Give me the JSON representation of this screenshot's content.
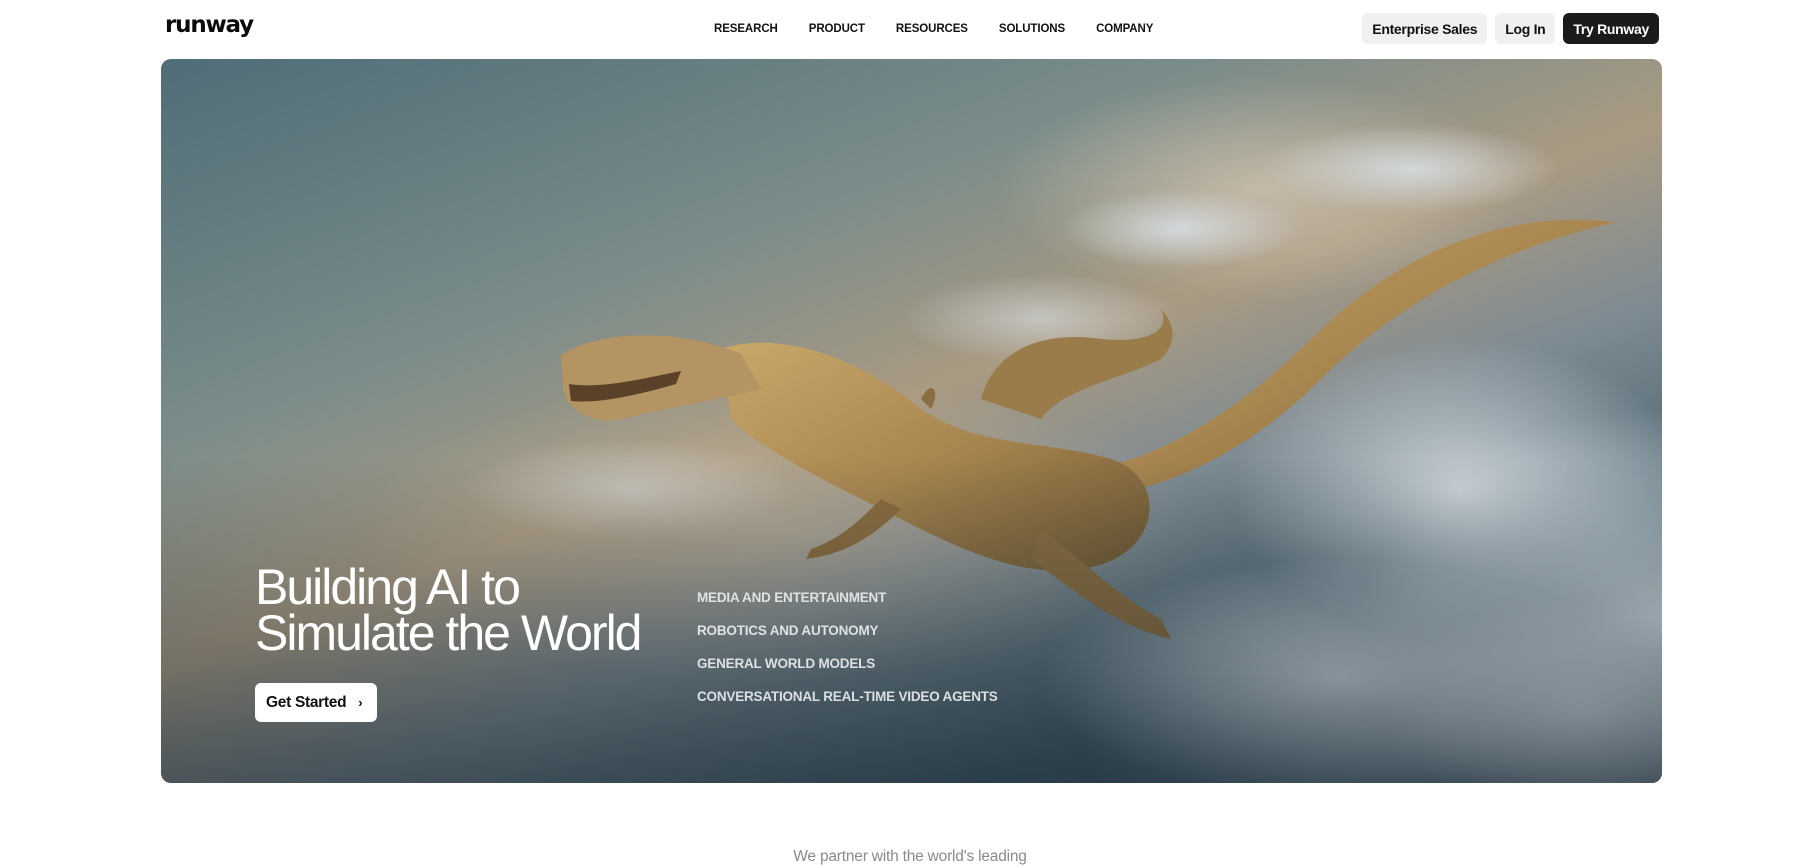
{
  "brand": {
    "logo_text": "runway"
  },
  "nav": {
    "items": [
      {
        "label": "RESEARCH"
      },
      {
        "label": "PRODUCT"
      },
      {
        "label": "RESOURCES"
      },
      {
        "label": "SOLUTIONS"
      },
      {
        "label": "COMPANY"
      }
    ]
  },
  "actions": {
    "enterprise_label": "Enterprise Sales",
    "login_label": "Log In",
    "try_label": "Try Runway"
  },
  "hero": {
    "headline_line1": "Building AI to",
    "headline_line2": "Simulate the World",
    "cta_label": "Get Started",
    "cta_icon": "chevron-right-icon",
    "topics": [
      {
        "label": "MEDIA AND ENTERTAINMENT"
      },
      {
        "label": "ROBOTICS AND AUTONOMY"
      },
      {
        "label": "GENERAL WORLD MODELS"
      },
      {
        "label": "CONVERSATIONAL REAL-TIME VIDEO AGENTS"
      }
    ]
  },
  "partner": {
    "text": "We partner with the world's leading"
  },
  "colors": {
    "dark_button": "#1b1b1b",
    "light_button": "#eef0f1"
  }
}
